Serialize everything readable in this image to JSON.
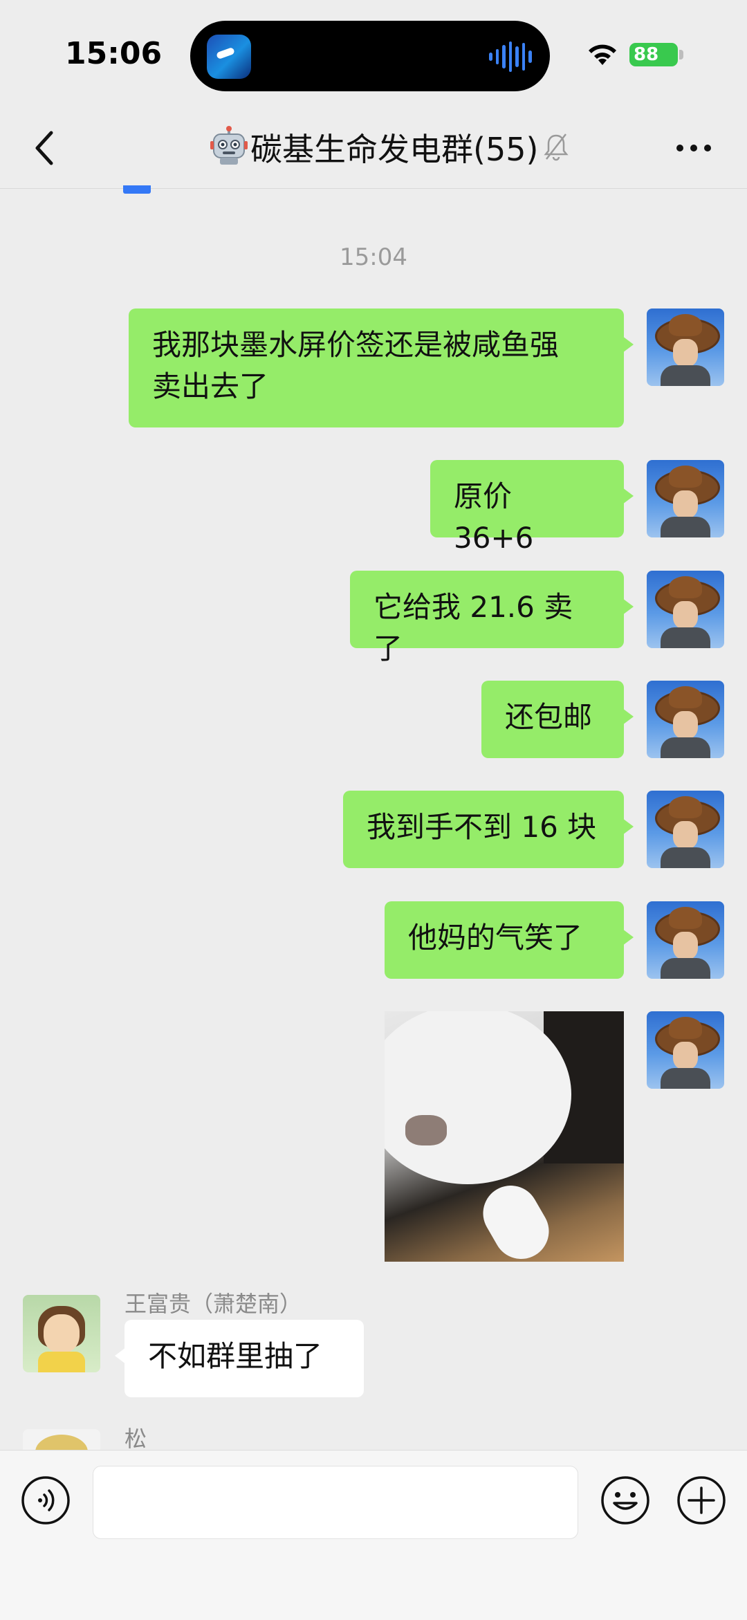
{
  "status_bar": {
    "time": "15:06",
    "battery": "88"
  },
  "header": {
    "back_icon": "chevron-left-icon",
    "title": "碳基生命发电群(55)",
    "title_emoji_icon": "robot-icon",
    "muted_icon": "bell-muted-icon",
    "more_icon": "ellipsis-icon"
  },
  "chat": {
    "timestamp": "15:04",
    "my_messages": [
      {
        "lines": [
          "我那块墨水屏价签还是被咸鱼强",
          "卖出去了"
        ]
      },
      {
        "text": "原价 36+6"
      },
      {
        "text": "它给我 21.6 卖了"
      },
      {
        "text": "还包邮"
      },
      {
        "text": "我到手不到 16 块"
      },
      {
        "text": "他妈的气笑了"
      }
    ],
    "sticker": "cat-sticker-image",
    "others": [
      {
        "name": "王富贵（萧楚南）",
        "text": "不如群里抽了"
      },
      {
        "name": "松"
      }
    ]
  },
  "input_bar": {
    "voice_icon": "voice-icon",
    "message_value": "",
    "emoji_icon": "emoji-icon",
    "plus_icon": "plus-icon"
  },
  "colors": {
    "background": "#ededed",
    "my_bubble": "#95ec69",
    "other_bubble": "#ffffff",
    "battery": "#39c94e"
  }
}
